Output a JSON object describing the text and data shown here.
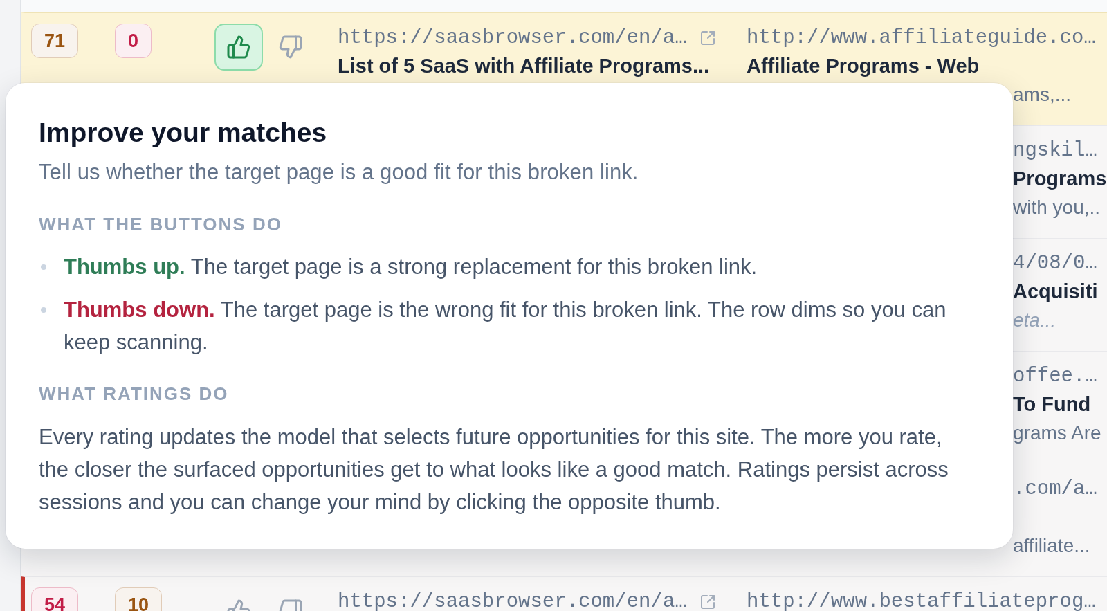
{
  "rows": [
    {
      "highlighted": true,
      "flagged": false,
      "scores": [
        {
          "value": "71",
          "color": "#9a5512"
        },
        {
          "value": "0",
          "color": "#c21d47"
        }
      ],
      "thumbs_up": {
        "selected": true
      },
      "thumbs_down": {
        "selected": false
      },
      "source": {
        "url": "https://saasbrowser.com/en/a…",
        "title": "List of 5 SaaS with Affiliate Programs..."
      },
      "target": {
        "url": "http://www.affiliateguide.co…",
        "title": "Affiliate Programs - Web",
        "snippet": "ams,..."
      }
    },
    {
      "highlighted": false,
      "target": {
        "url": "ngskil…",
        "title": "Programs",
        "snippet": "with you,.."
      }
    },
    {
      "highlighted": false,
      "target": {
        "url": "4/08/0…",
        "title": "Acquisiti",
        "snippet": "eta...",
        "snippet_italic": true
      }
    },
    {
      "highlighted": false,
      "target": {
        "url": "offee.…",
        "title": "To Fund",
        "snippet": "grams Are"
      }
    },
    {
      "highlighted": false,
      "target": {
        "url": ".com/a…",
        "snippet": "affiliate..."
      }
    },
    {
      "highlighted": false,
      "flagged": true,
      "scores": [
        {
          "value": "54",
          "color": "#c21d47"
        },
        {
          "value": "10",
          "color": "#9a5512"
        }
      ],
      "thumbs_up": {
        "selected": false
      },
      "thumbs_down": {
        "selected": false
      },
      "source": {
        "url": "https://saasbrowser.com/en/a…"
      },
      "target": {
        "url": "http://www.bestaffiliateprog…"
      }
    }
  ],
  "popover": {
    "title": "Improve your matches",
    "subtitle": "Tell us whether the target page is a good fit for this broken link.",
    "sections": [
      {
        "heading": "WHAT THE BUTTONS DO",
        "kind": "bullets",
        "items": [
          {
            "kind": "up",
            "lead": "Thumbs up.",
            "text": "The target page is a strong replacement for this broken link."
          },
          {
            "kind": "down",
            "lead": "Thumbs down.",
            "text": "The target page is the wrong fit for this broken link. The row dims so you can keep scanning."
          }
        ]
      },
      {
        "heading": "WHAT RATINGS DO",
        "kind": "paragraph",
        "text": "Every rating updates the model that selects future opportunities for this site. The more you rate, the closer the surfaced opportunities get to what looks like a good match. Ratings persist across sessions and you can change your mind by clicking the opposite thumb."
      }
    ]
  }
}
